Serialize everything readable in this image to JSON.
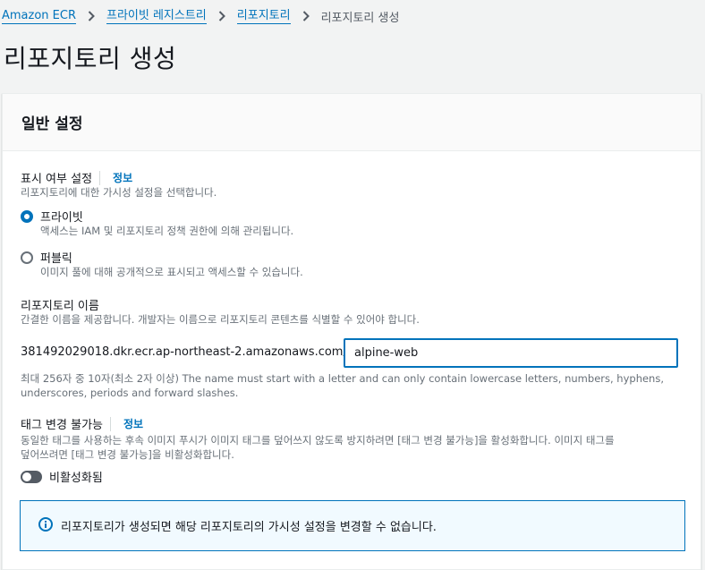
{
  "breadcrumb": {
    "items": [
      "Amazon ECR",
      "프라이빗 레지스트리",
      "리포지토리"
    ],
    "current": "리포지토리 생성"
  },
  "page": {
    "title": "리포지토리 생성"
  },
  "panel": {
    "title": "일반 설정",
    "visibility": {
      "label": "표시 여부 설정",
      "info": "정보",
      "description": "리포지토리에 대한 가시성 설정을 선택합니다.",
      "options": [
        {
          "label": "프라이빗",
          "description": "액세스는 IAM 및 리포지토리 정책 권한에 의해 관리됩니다.",
          "selected": true
        },
        {
          "label": "퍼블릭",
          "description": "이미지 풀에 대해 공개적으로 표시되고 액세스할 수 있습니다.",
          "selected": false
        }
      ]
    },
    "repo_name": {
      "label": "리포지토리 이름",
      "description": "간결한 이름을 제공합니다. 개발자는 이름으로 리포지토리 콘텐츠를 식별할 수 있어야 합니다.",
      "prefix": "381492029018.dkr.ecr.ap-northeast-2.amazonaws.com/",
      "value": "alpine-web",
      "constraint_line1": "최대 256자 중 10자(최소 2자 이상) The name must start with a letter and can only contain lowercase letters, numbers, hyphens,",
      "constraint_line2": "underscores, periods and forward slashes."
    },
    "tag_immutability": {
      "label": "태그 변경 불가능",
      "info": "정보",
      "description_line1": "동일한 태그를 사용하는 후속 이미지 푸시가 이미지 태그를 덮어쓰지 않도록 방지하려면 [태그 변경 불가능]을 활성화합니다. 이미지 태그를",
      "description_line2": "덮어쓰려면 [태그 변경 불가능]을 비활성화합니다.",
      "toggle_label": "비활성화됨",
      "enabled": false
    },
    "info_alert": "리포지토리가 생성되면 해당 리포지토리의 가시성 설정을 변경할 수 없습니다."
  },
  "colors": {
    "link": "#0073bb",
    "background": "#f2f3f3",
    "info_bg": "#f1faff"
  }
}
